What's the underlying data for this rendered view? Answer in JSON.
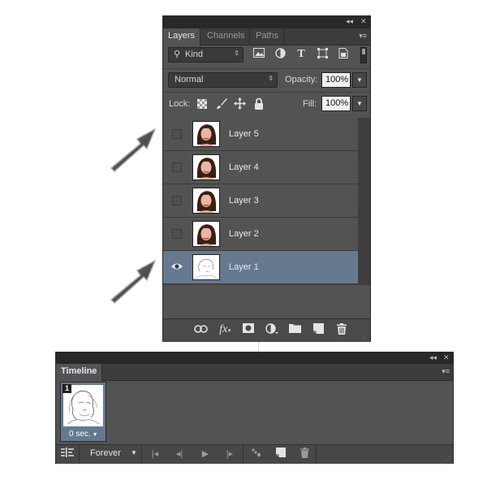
{
  "layers_panel": {
    "collapse_glyph": "◂◂",
    "close_glyph": "✕",
    "tabs": [
      {
        "label": "Layers",
        "active": true
      },
      {
        "label": "Channels",
        "active": false
      },
      {
        "label": "Paths",
        "active": false
      }
    ],
    "flyout_glyph": "▾≡",
    "filter": {
      "icon": "search-icon",
      "label": "Kind"
    },
    "filter_icons": [
      "image-filter-icon",
      "adjustment-filter-icon",
      "type-filter-icon",
      "shape-filter-icon",
      "smart-object-filter-icon",
      "filter-toggle"
    ],
    "blend_mode": "Normal",
    "opacity_label": "Opacity:",
    "opacity_value": "100%",
    "lock_label": "Lock:",
    "lock_icons": [
      "lock-transparent-icon",
      "lock-image-icon",
      "lock-position-icon",
      "lock-all-icon"
    ],
    "fill_label": "Fill:",
    "fill_value": "100%",
    "layers": [
      {
        "name": "Layer 5",
        "visible": false,
        "selected": false,
        "thumb": "portrait"
      },
      {
        "name": "Layer 4",
        "visible": false,
        "selected": false,
        "thumb": "portrait"
      },
      {
        "name": "Layer 3",
        "visible": false,
        "selected": false,
        "thumb": "portrait"
      },
      {
        "name": "Layer 2",
        "visible": false,
        "selected": false,
        "thumb": "portrait"
      },
      {
        "name": "Layer 1",
        "visible": true,
        "selected": true,
        "thumb": "sketch"
      }
    ],
    "bottom_icons": [
      "link-icon",
      "fx-icon",
      "mask-icon",
      "adjustment-icon",
      "folder-icon",
      "new-layer-icon",
      "trash-icon"
    ],
    "fx_label": "fx"
  },
  "timeline_panel": {
    "collapse_glyph": "◂◂",
    "close_glyph": "✕",
    "tab_label": "Timeline",
    "flyout_glyph": "▾≡",
    "frame": {
      "number": "1",
      "delay": "0 sec.",
      "thumb": "sketch"
    },
    "loop_value": "Forever",
    "controls": [
      "convert-icon",
      "first-frame-icon",
      "prev-frame-icon",
      "play-icon",
      "next-frame-icon",
      "tween-icon",
      "duplicate-frame-icon",
      "delete-frame-icon"
    ]
  },
  "colors": {
    "panel_bg": "#535353",
    "selected_row": "#66798f",
    "dark_bar": "#282828",
    "arrow": "#4a4a4a"
  }
}
